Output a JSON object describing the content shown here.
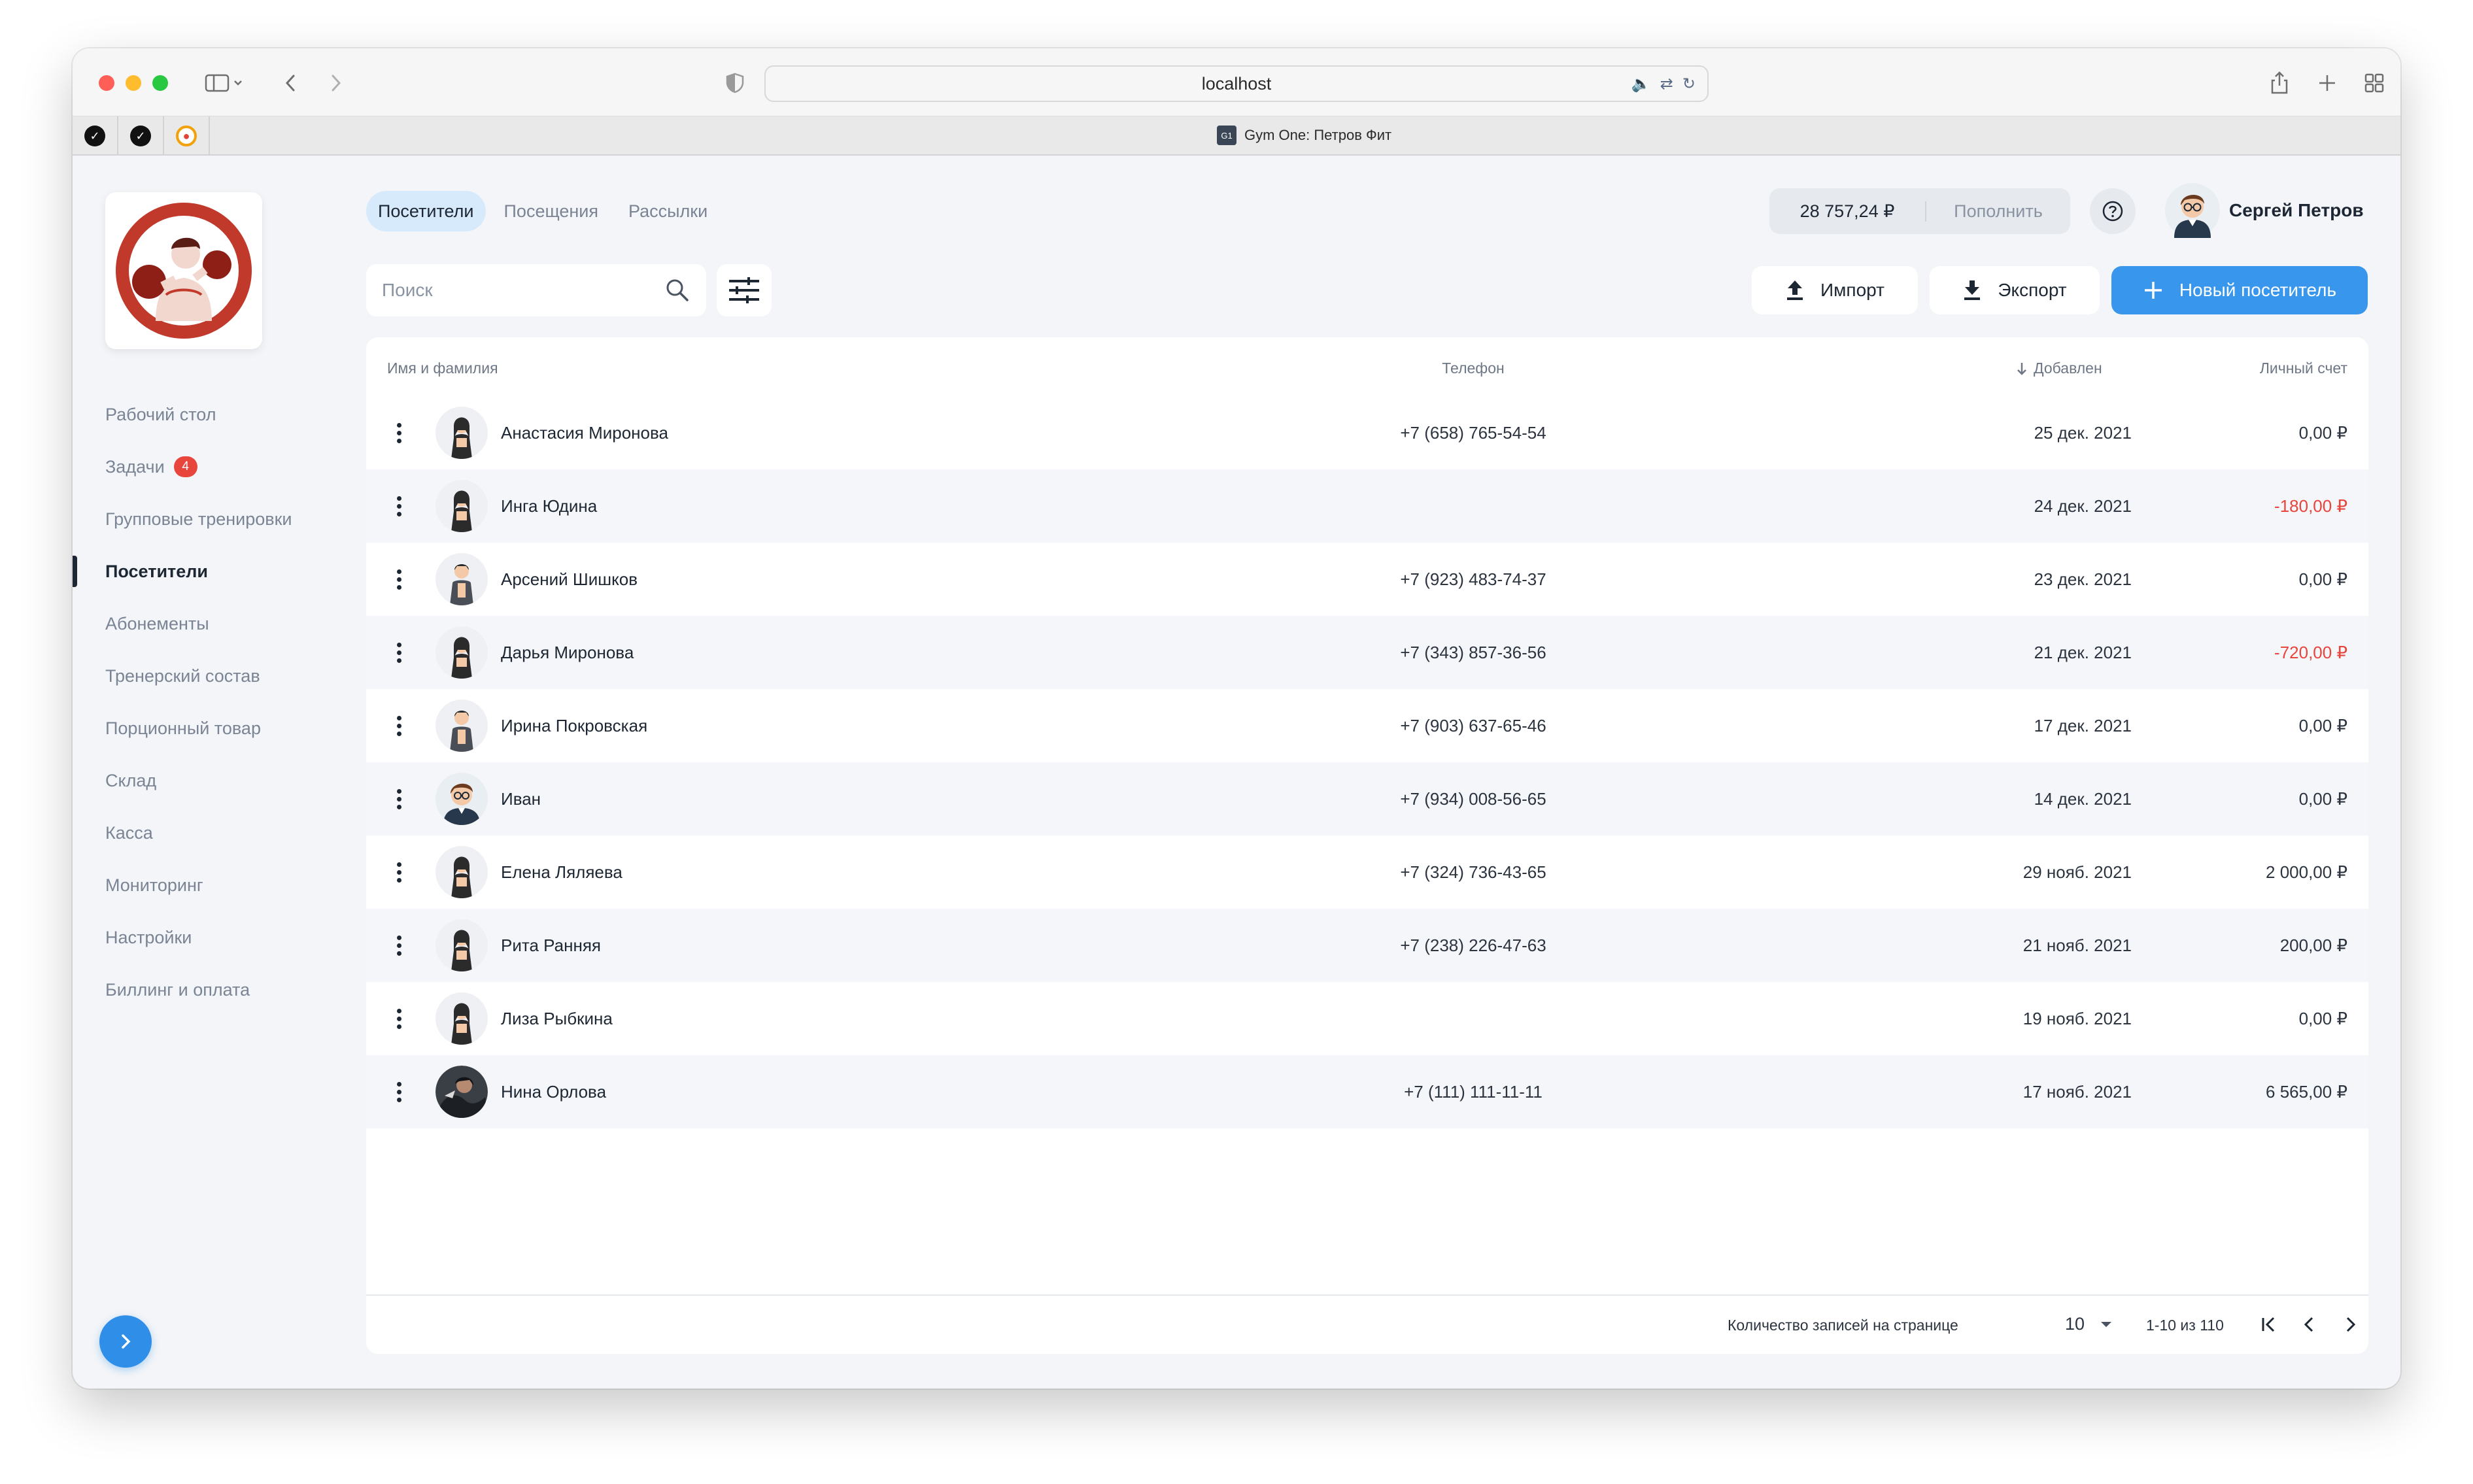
{
  "browser": {
    "url": "localhost",
    "tab_title": "Gym One: Петров Фит",
    "tab_favicon": "G1"
  },
  "nav": {
    "items": [
      {
        "label": "Рабочий стол"
      },
      {
        "label": "Задачи",
        "badge": "4"
      },
      {
        "label": "Групповые тренировки"
      },
      {
        "label": "Посетители",
        "active": true
      },
      {
        "label": "Абонементы"
      },
      {
        "label": "Тренерский состав"
      },
      {
        "label": "Порционный товар"
      },
      {
        "label": "Склад"
      },
      {
        "label": "Касса"
      },
      {
        "label": "Мониторинг"
      },
      {
        "label": "Настройки"
      },
      {
        "label": "Биллинг и оплата"
      }
    ]
  },
  "tabs": [
    {
      "label": "Посетители",
      "active": true
    },
    {
      "label": "Посещения"
    },
    {
      "label": "Рассылки"
    }
  ],
  "balance": {
    "amount": "28 757,24 ₽",
    "topup_label": "Пополнить"
  },
  "user": {
    "name": "Сергей Петров"
  },
  "search": {
    "placeholder": "Поиск"
  },
  "actions": {
    "import_label": "Импорт",
    "export_label": "Экспорт",
    "new_label": "Новый посетитель"
  },
  "table": {
    "headers": {
      "name": "Имя и фамилия",
      "phone": "Телефон",
      "added": "Добавлен",
      "account": "Личный счет"
    },
    "rows": [
      {
        "name": "Анастасия Миронова",
        "phone": "+7 (658) 765-54-54",
        "added": "25 дек. 2021",
        "account": "0,00 ₽",
        "negative": false,
        "avatar": "woman-avatar"
      },
      {
        "name": "Инга Юдина",
        "phone": "",
        "added": "24 дек. 2021",
        "account": "-180,00 ₽",
        "negative": true,
        "avatar": "woman-avatar"
      },
      {
        "name": "Арсений Шишков",
        "phone": "+7 (923) 483-74-37",
        "added": "23 дек. 2021",
        "account": "0,00 ₽",
        "negative": false,
        "avatar": "man-avatar"
      },
      {
        "name": "Дарья Миронова",
        "phone": "+7 (343) 857-36-56",
        "added": "21 дек. 2021",
        "account": "-720,00 ₽",
        "negative": true,
        "avatar": "woman-avatar"
      },
      {
        "name": "Ирина Покровская",
        "phone": "+7 (903) 637-65-46",
        "added": "17 дек. 2021",
        "account": "0,00 ₽",
        "negative": false,
        "avatar": "man-avatar"
      },
      {
        "name": "Иван",
        "phone": "+7 (934) 008-56-65",
        "added": "14 дек. 2021",
        "account": "0,00 ₽",
        "negative": false,
        "avatar": "glasses-avatar"
      },
      {
        "name": "Елена Ляляева",
        "phone": "+7 (324) 736-43-65",
        "added": "29 нояб. 2021",
        "account": "2 000,00 ₽",
        "negative": false,
        "avatar": "woman-avatar"
      },
      {
        "name": "Рита Ранняя",
        "phone": "+7 (238) 226-47-63",
        "added": "21 нояб. 2021",
        "account": "200,00 ₽",
        "negative": false,
        "avatar": "woman-avatar"
      },
      {
        "name": "Лиза Рыбкина",
        "phone": "",
        "added": "19 нояб. 2021",
        "account": "0,00 ₽",
        "negative": false,
        "avatar": "woman-avatar"
      },
      {
        "name": "Нина Орлова",
        "phone": "+7 (111) 111-11-11",
        "added": "17 нояб. 2021",
        "account": "6 565,00 ₽",
        "negative": false,
        "avatar": "photo-avatar"
      }
    ]
  },
  "pagination": {
    "label": "Количество записей на странице",
    "page_size": "10",
    "range": "1-10 из 110"
  },
  "colors": {
    "accent": "#3897ec",
    "negative": "#e8453c",
    "tab_active_bg": "#d6eafc",
    "brand_red": "#c0392b"
  }
}
